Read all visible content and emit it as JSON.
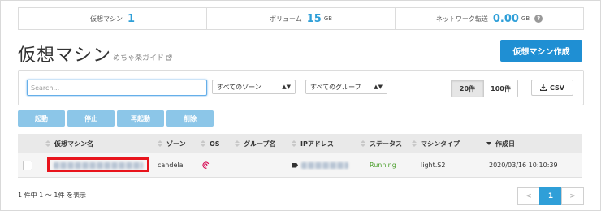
{
  "stats": {
    "vm_label": "仮想マシン",
    "vm_count": "1",
    "volume_label": "ボリューム",
    "volume_value": "15",
    "volume_unit": "GB",
    "network_label": "ネットワーク転送",
    "network_value": "0.00",
    "network_unit": "GB",
    "help_icon": "?"
  },
  "header": {
    "title": "仮想マシン",
    "guide_link": "めちゃ楽ガイド",
    "guide_icon": "external-link-icon",
    "create_button": "仮想マシン作成"
  },
  "filters": {
    "search_placeholder": "Search...",
    "zone_select": "すべてのゾーン",
    "group_select": "すべてのグループ",
    "page_size_options": [
      "20件",
      "100件"
    ],
    "page_size_selected": "20件",
    "csv_button": "CSV"
  },
  "actions": [
    "起動",
    "停止",
    "再起動",
    "削除"
  ],
  "table": {
    "columns": [
      "仮想マシン名",
      "ゾーン",
      "OS",
      "グループ名",
      "IPアドレス",
      "ステータス",
      "マシンタイプ",
      "作成日"
    ],
    "rows": [
      {
        "name": "(redacted)",
        "zone": "candela",
        "os_icon": "debian-icon",
        "group": "",
        "ip": "(redacted)",
        "status": "Running",
        "machine_type": "light.S2",
        "created": "2020/03/16 10:10:39"
      }
    ]
  },
  "footer": {
    "count_text": "1 件中 1 ～ 1件 を表示",
    "pagination": {
      "prev": "<",
      "current": "1",
      "next": ">"
    }
  },
  "colors": {
    "accent": "#2f9fd8",
    "create_button": "#1f8fd3",
    "action_button": "#8cc6e8",
    "status_running": "#4a9e2a",
    "highlight": "#e8141c"
  }
}
